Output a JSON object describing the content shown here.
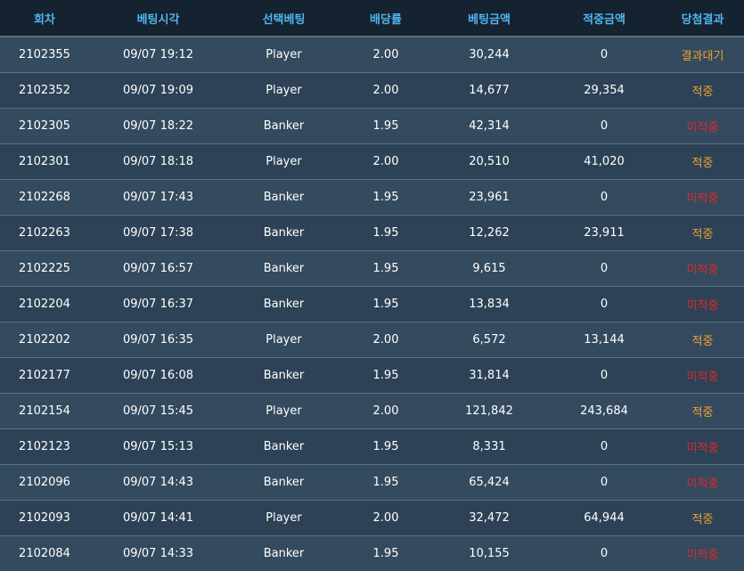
{
  "headers": [
    "회차",
    "베팅시각",
    "선택베팅",
    "배당률",
    "베팅금액",
    "적중금액",
    "당첨결과"
  ],
  "rows": [
    {
      "round": "2102355",
      "time": "09/07 19:12",
      "pick": "Player",
      "odds": "2.00",
      "bet": "30,244",
      "win": "0",
      "result": "결과대기",
      "status": "wait"
    },
    {
      "round": "2102352",
      "time": "09/07 19:09",
      "pick": "Player",
      "odds": "2.00",
      "bet": "14,677",
      "win": "29,354",
      "result": "적중",
      "status": "hit"
    },
    {
      "round": "2102305",
      "time": "09/07 18:22",
      "pick": "Banker",
      "odds": "1.95",
      "bet": "42,314",
      "win": "0",
      "result": "미적중",
      "status": "miss"
    },
    {
      "round": "2102301",
      "time": "09/07 18:18",
      "pick": "Player",
      "odds": "2.00",
      "bet": "20,510",
      "win": "41,020",
      "result": "적중",
      "status": "hit"
    },
    {
      "round": "2102268",
      "time": "09/07 17:43",
      "pick": "Banker",
      "odds": "1.95",
      "bet": "23,961",
      "win": "0",
      "result": "미적중",
      "status": "miss"
    },
    {
      "round": "2102263",
      "time": "09/07 17:38",
      "pick": "Banker",
      "odds": "1.95",
      "bet": "12,262",
      "win": "23,911",
      "result": "적중",
      "status": "hit"
    },
    {
      "round": "2102225",
      "time": "09/07 16:57",
      "pick": "Banker",
      "odds": "1.95",
      "bet": "9,615",
      "win": "0",
      "result": "미적중",
      "status": "miss"
    },
    {
      "round": "2102204",
      "time": "09/07 16:37",
      "pick": "Banker",
      "odds": "1.95",
      "bet": "13,834",
      "win": "0",
      "result": "미적중",
      "status": "miss"
    },
    {
      "round": "2102202",
      "time": "09/07 16:35",
      "pick": "Player",
      "odds": "2.00",
      "bet": "6,572",
      "win": "13,144",
      "result": "적중",
      "status": "hit"
    },
    {
      "round": "2102177",
      "time": "09/07 16:08",
      "pick": "Banker",
      "odds": "1.95",
      "bet": "31,814",
      "win": "0",
      "result": "미적중",
      "status": "miss"
    },
    {
      "round": "2102154",
      "time": "09/07 15:45",
      "pick": "Player",
      "odds": "2.00",
      "bet": "121,842",
      "win": "243,684",
      "result": "적중",
      "status": "hit"
    },
    {
      "round": "2102123",
      "time": "09/07 15:13",
      "pick": "Banker",
      "odds": "1.95",
      "bet": "8,331",
      "win": "0",
      "result": "미적중",
      "status": "miss"
    },
    {
      "round": "2102096",
      "time": "09/07 14:43",
      "pick": "Banker",
      "odds": "1.95",
      "bet": "65,424",
      "win": "0",
      "result": "미적중",
      "status": "miss"
    },
    {
      "round": "2102093",
      "time": "09/07 14:41",
      "pick": "Player",
      "odds": "2.00",
      "bet": "32,472",
      "win": "64,944",
      "result": "적중",
      "status": "hit"
    },
    {
      "round": "2102084",
      "time": "09/07 14:33",
      "pick": "Banker",
      "odds": "1.95",
      "bet": "10,155",
      "win": "0",
      "result": "미적중",
      "status": "miss"
    }
  ],
  "colors": {
    "header_bg": "#152230",
    "header_text": "#4fb5ee",
    "row_odd": "#344a5e",
    "row_even": "#2d4256",
    "wait": "#f0a030",
    "hit": "#f0a030",
    "miss": "#e02828"
  }
}
